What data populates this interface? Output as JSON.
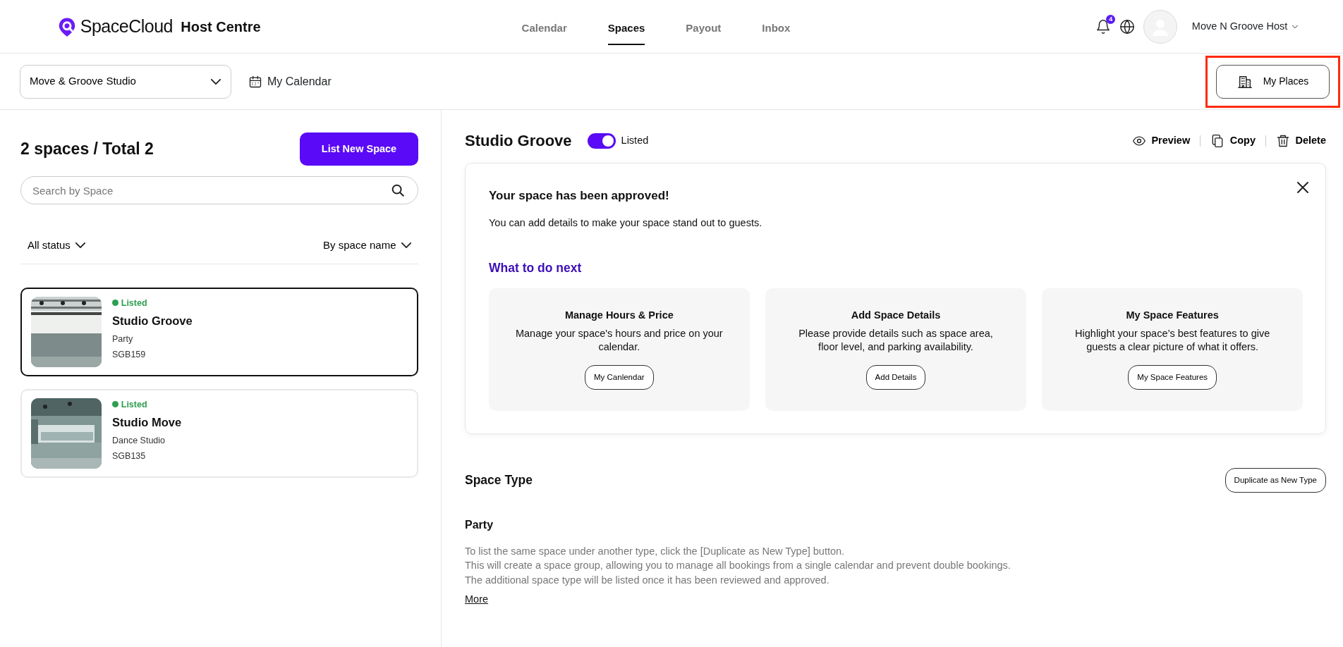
{
  "header": {
    "brand": "SpaceCloud",
    "product": "Host Centre",
    "nav": [
      {
        "label": "Calendar",
        "selected": false
      },
      {
        "label": "Spaces",
        "selected": true
      },
      {
        "label": "Payout",
        "selected": false
      },
      {
        "label": "Inbox",
        "selected": false
      }
    ],
    "notification_count": "4",
    "user": "Move N Groove Host"
  },
  "toolbar": {
    "place_select": "Move & Groove Studio",
    "calendar_link": "My Calendar",
    "my_places": {
      "label": "My Places",
      "highlighted": true
    }
  },
  "space_list": {
    "title": "2 spaces / Total 2",
    "new_button": "List New Space",
    "search": {
      "placeholder": "Search by Space"
    },
    "status_filter": "All status",
    "sort": "By space name",
    "spaces": [
      {
        "status": "Listed",
        "color": "#2e9e4f",
        "name": "Studio Groove",
        "type": "Party",
        "code": "SGB159",
        "selected": true,
        "kind": "picture"
      },
      {
        "status": "Listed",
        "color": "#2e9e4f",
        "name": "Studio Move",
        "type": "Dance Studio",
        "code": "SGB135",
        "selected": false,
        "kind": "picture"
      }
    ]
  },
  "detail": {
    "title": "Studio Groove",
    "listed": true,
    "listed_label": "Listed",
    "actions": [
      "Preview",
      "Copy",
      "Delete"
    ],
    "notice": {
      "title": "Your space has been approved!",
      "text": "You can add details to make your space stand out to guests.",
      "next_heading": "What to do next",
      "steps": [
        {
          "title": "Manage Hours & Price",
          "text": "Manage your space's hours and price on your calendar.",
          "button": "My Canlendar"
        },
        {
          "title": "Add Space Details",
          "text": "Please provide details such as space area, floor level, and parking availability.",
          "button": "Add Details"
        },
        {
          "title": "My Space Features",
          "text": "Highlight your space’s best features to give guests a clear picture of what it offers.",
          "button": "My Space Features"
        }
      ]
    },
    "space_type": {
      "heading": "Space Type",
      "button": "Duplicate as New Type",
      "type": "Party",
      "lines": [
        "To list the same space under another type, click the [Duplicate as New Type] button.",
        "This will create a space group, allowing you to manage all bookings from a single calendar and prevent double bookings.",
        "The additional space type will be listed once it has been reviewed and approved."
      ],
      "more": "More"
    }
  }
}
